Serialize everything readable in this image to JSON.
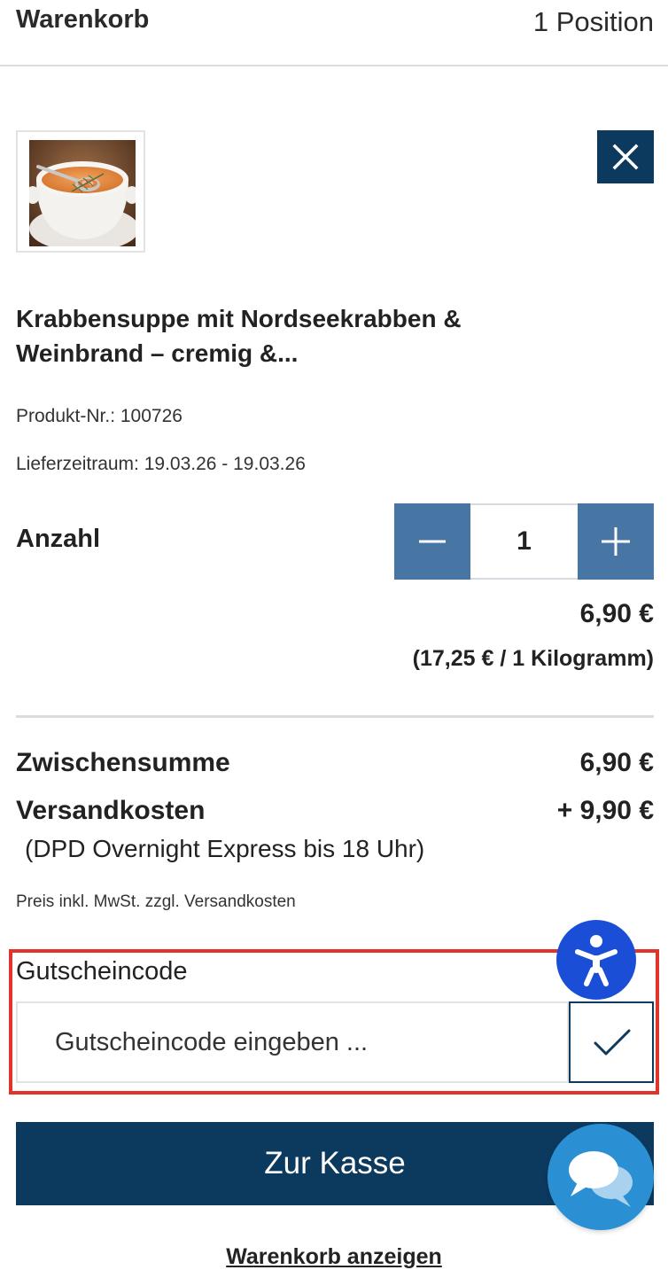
{
  "header": {
    "title": "Warenkorb",
    "count": "1 Position"
  },
  "item": {
    "name_line1": "Krabbensuppe mit Nordseekrabben &",
    "name_line2": "Weinbrand – cremig &...",
    "product_no": "Produkt-Nr.: 100726",
    "delivery": "Lieferzeitraum: 19.03.26 - 19.03.26",
    "quantity_label": "Anzahl",
    "quantity": "1",
    "price": "6,90 €",
    "unit_price": "(17,25 € / 1 Kilogramm)"
  },
  "summary": {
    "subtotal_label": "Zwischensumme",
    "subtotal": "6,90 €",
    "shipping_label": "Versandkosten",
    "shipping": "+ 9,90 €",
    "shipping_method": "(DPD Overnight Express bis 18 Uhr)",
    "tax_note": "Preis inkl. MwSt. zzgl. Versandkosten"
  },
  "voucher": {
    "label": "Gutscheincode",
    "placeholder": "Gutscheincode eingeben ..."
  },
  "actions": {
    "checkout": "Zur Kasse",
    "view_cart": "Warenkorb anzeigen"
  },
  "icons": {
    "remove": "close-icon",
    "minus": "minus-icon",
    "plus": "plus-icon",
    "apply": "checkmark-icon",
    "accessibility": "accessibility-icon",
    "chat": "chat-bubbles-icon"
  },
  "colors": {
    "primary": "#0c3a5e",
    "stepper": "#4776a5",
    "highlight": "#e2332a",
    "accessibility": "#1a4ed6",
    "chat": "#2b8fd3"
  }
}
